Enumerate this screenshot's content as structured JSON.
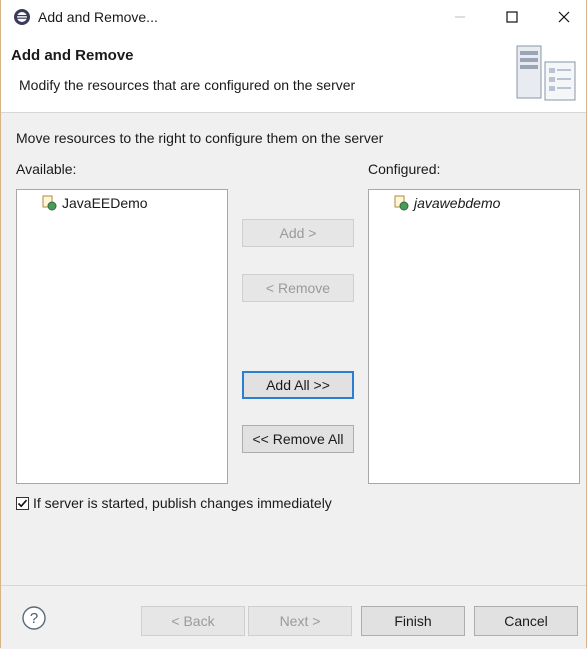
{
  "window": {
    "title": "Add and Remove..."
  },
  "header": {
    "title": "Add and Remove",
    "description": "Modify the resources that are configured on the server"
  },
  "content": {
    "instruction": "Move resources to the right to configure them on the server",
    "available_label": "Available:",
    "configured_label": "Configured:",
    "available_items": [
      {
        "label": "JavaEEDemo",
        "icon": "web-project-icon"
      }
    ],
    "configured_items": [
      {
        "label": "javawebdemo",
        "icon": "web-project-icon"
      }
    ]
  },
  "buttons": {
    "add": "Add >",
    "remove": "< Remove",
    "add_all": "Add All >>",
    "remove_all": "<< Remove All"
  },
  "options": {
    "publish_immediately_label": "If server is started, publish changes immediately",
    "publish_immediately_checked": true
  },
  "footer": {
    "back": "< Back",
    "next": "Next >",
    "finish": "Finish",
    "cancel": "Cancel"
  },
  "colors": {
    "focus_border": "#2a7fd4",
    "disabled_text": "#9a9a9a"
  }
}
